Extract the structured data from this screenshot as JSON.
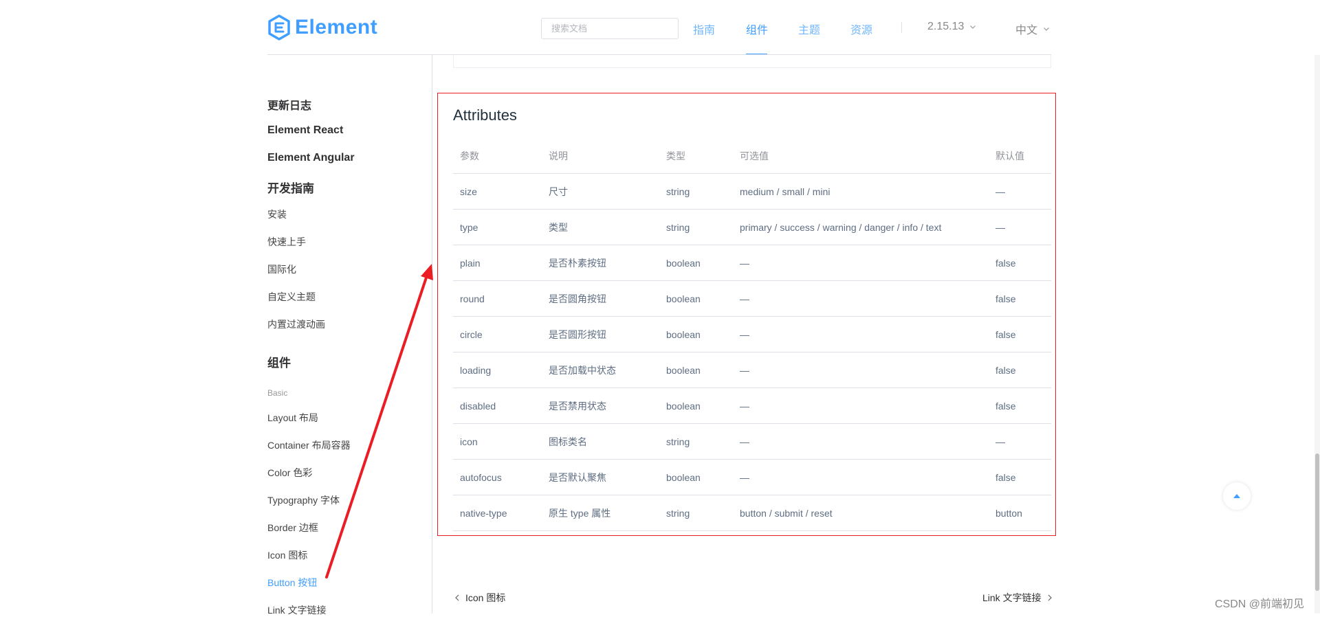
{
  "header": {
    "logo_text": "Element",
    "search": {
      "placeholder": "搜索文档",
      "value": ""
    },
    "nav": [
      {
        "label": "指南"
      },
      {
        "label": "组件"
      },
      {
        "label": "主题"
      },
      {
        "label": "资源"
      }
    ],
    "active_nav": "组件",
    "version": "2.15.13",
    "language": "中文"
  },
  "sidebar": {
    "top_links": [
      "更新日志",
      "Element React",
      "Element Angular"
    ],
    "guide_title": "开发指南",
    "guide_items": [
      "安装",
      "快速上手",
      "国际化",
      "自定义主题",
      "内置过渡动画"
    ],
    "components_title": "组件",
    "basic_category": "Basic",
    "basic_items": [
      "Layout 布局",
      "Container 布局容器",
      "Color 色彩",
      "Typography 字体",
      "Border 边框",
      "Icon 图标",
      "Button 按钮",
      "Link 文字链接"
    ],
    "active_item": "Button 按钮"
  },
  "attributes": {
    "title": "Attributes",
    "columns": [
      "参数",
      "说明",
      "类型",
      "可选值",
      "默认值"
    ],
    "rows": [
      [
        "size",
        "尺寸",
        "string",
        "medium / small / mini",
        "—"
      ],
      [
        "type",
        "类型",
        "string",
        "primary / success / warning / danger / info / text",
        "—"
      ],
      [
        "plain",
        "是否朴素按钮",
        "boolean",
        "—",
        "false"
      ],
      [
        "round",
        "是否圆角按钮",
        "boolean",
        "—",
        "false"
      ],
      [
        "circle",
        "是否圆形按钮",
        "boolean",
        "—",
        "false"
      ],
      [
        "loading",
        "是否加载中状态",
        "boolean",
        "—",
        "false"
      ],
      [
        "disabled",
        "是否禁用状态",
        "boolean",
        "—",
        "false"
      ],
      [
        "icon",
        "图标类名",
        "string",
        "—",
        "—"
      ],
      [
        "autofocus",
        "是否默认聚焦",
        "boolean",
        "—",
        "false"
      ],
      [
        "native-type",
        "原生 type 属性",
        "string",
        "button / submit / reset",
        "button"
      ]
    ]
  },
  "footer_nav": {
    "prev": "Icon 图标",
    "next": "Link 文字链接"
  },
  "watermark": "CSDN @前端初见",
  "colors": {
    "brand": "#409eff",
    "annotation_red": "#ea1c24"
  },
  "icons": {
    "logo": "element-logo-icon",
    "chevron": "chevron-down-icon",
    "backtop": "caret-up-icon",
    "prev": "chevron-left-icon",
    "next": "chevron-right-icon"
  }
}
